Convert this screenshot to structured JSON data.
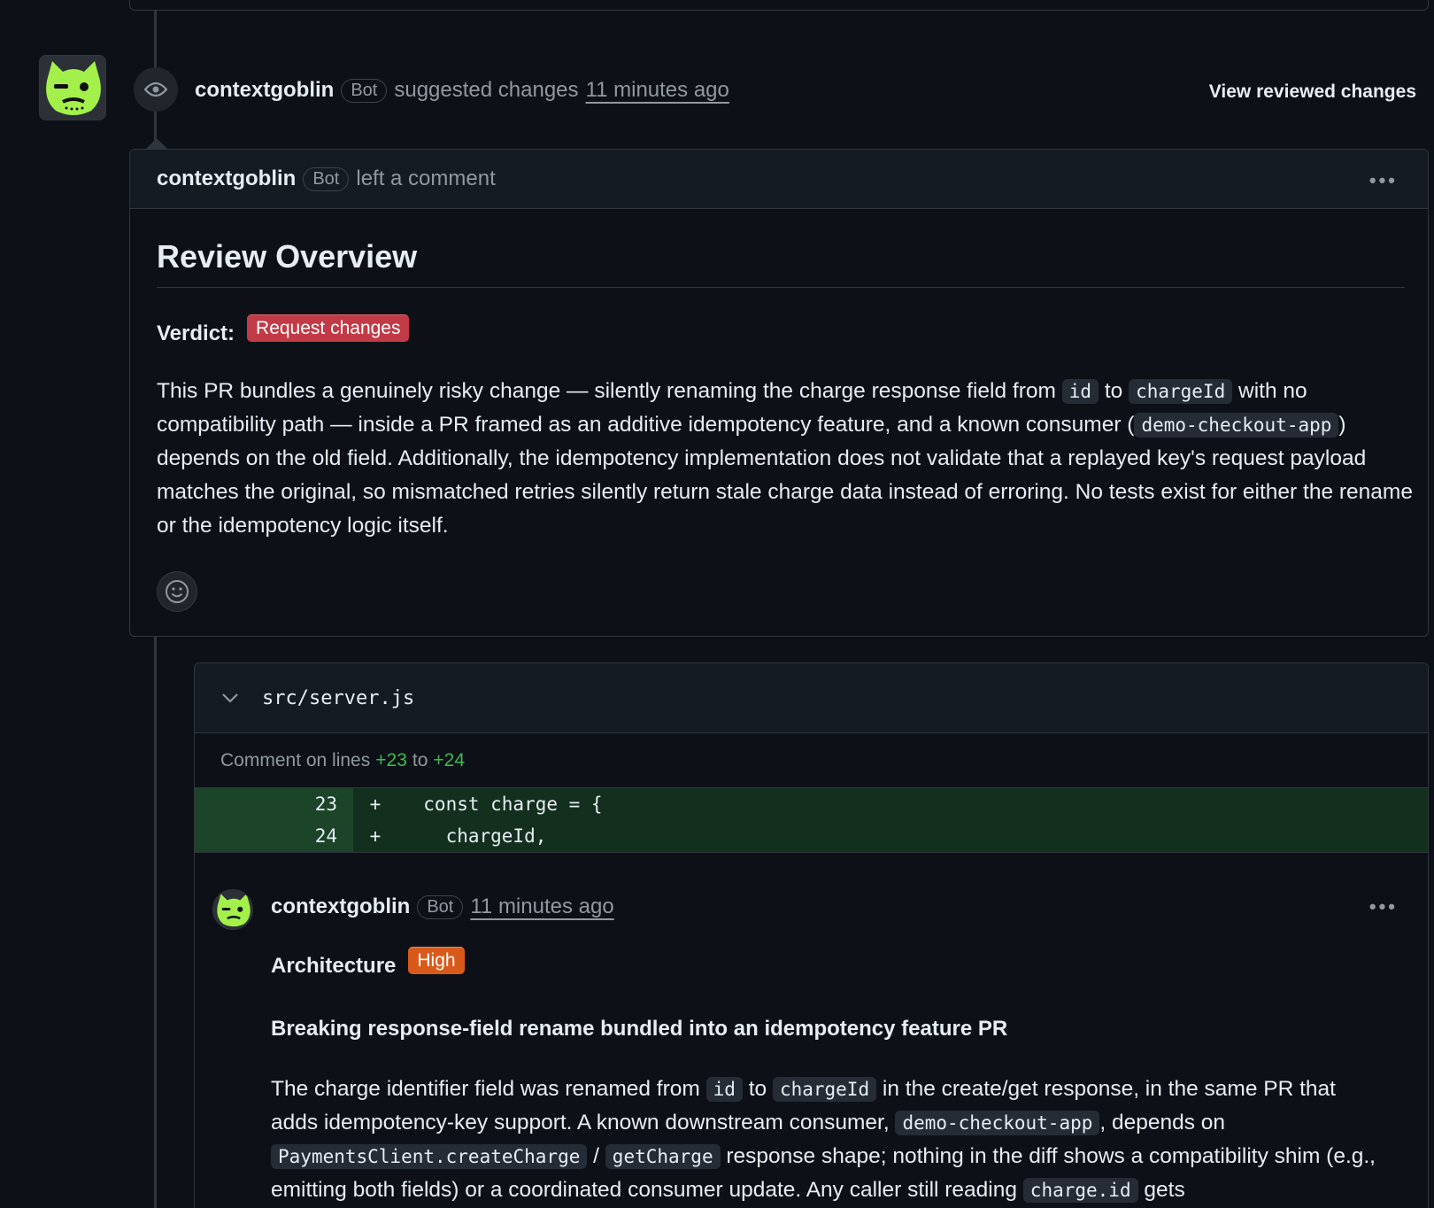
{
  "review": {
    "author": "contextgoblin",
    "bot_label": "Bot",
    "action": "suggested changes",
    "time": "11 minutes ago",
    "view_reviewed": "View reviewed changes"
  },
  "comment": {
    "author": "contextgoblin",
    "bot_label": "Bot",
    "action": "left a comment",
    "heading": "Review Overview",
    "verdict_label": "Verdict:",
    "verdict_value": "Request changes",
    "body": {
      "t1": "This PR bundles a genuinely risky change — silently renaming the charge response field from ",
      "c1": "id",
      "t2": " to ",
      "c2": "chargeId",
      "t3": " with no compatibility path — inside a PR framed as an additive idempotency feature, and a known consumer (",
      "c3": "demo-checkout-app",
      "t4": ") depends on the old field. Additionally, the idempotency implementation does not validate that a replayed key's request payload matches the original, so mismatched retries silently return stale charge data instead of erroring. No tests exist for either the rename or the idempotency logic itself."
    }
  },
  "file": {
    "name": "src/server.js",
    "comment_on": "Comment on lines",
    "line_start": "+23",
    "to_word": "to",
    "line_end": "+24",
    "diff": [
      {
        "num": "23",
        "sign": "+",
        "code": "  const charge = {"
      },
      {
        "num": "24",
        "sign": "+",
        "code": "    chargeId,"
      }
    ]
  },
  "review_comment": {
    "author": "contextgoblin",
    "bot_label": "Bot",
    "time": "11 minutes ago",
    "category": "Architecture",
    "severity": "High",
    "title": "Breaking response-field rename bundled into an idempotency feature PR",
    "body": {
      "t1": "The charge identifier field was renamed from ",
      "c1": "id",
      "t2": " to ",
      "c2": "chargeId",
      "t3": " in the create/get response, in the same PR that adds idempotency-key support. A known downstream consumer, ",
      "c3": "demo-checkout-app",
      "t4": ", depends on ",
      "c4": "PaymentsClient.createCharge",
      "t5": " / ",
      "c5": "getCharge",
      "t6": " response shape; nothing in the diff shows a compatibility shim (e.g., emitting both fields) or a coordinated consumer update. Any caller still reading ",
      "c6": "charge.id",
      "t7": " gets"
    }
  },
  "colors": {
    "background": "#0d1117",
    "danger": "#c13a46",
    "severity_high": "#d9591b",
    "added_line": "#13301e",
    "added_green": "#3fb950",
    "avatar_green": "#a4f04a"
  }
}
